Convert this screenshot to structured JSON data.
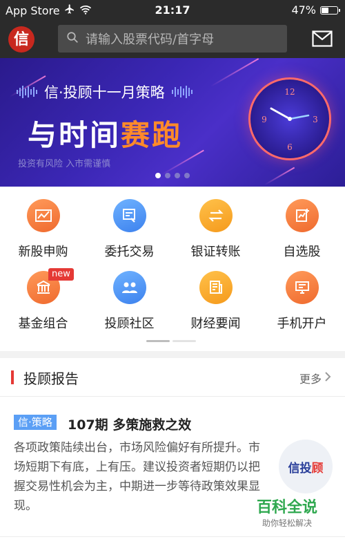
{
  "status": {
    "back_app": "App Store",
    "time": "21:17",
    "battery": "47%"
  },
  "header": {
    "logo_char": "信",
    "search_placeholder": "请输入股票代码/首字母",
    "icons": {
      "search": "search-icon",
      "mail": "mail-icon"
    }
  },
  "banner": {
    "subtitle": "信·投顾十一月策略",
    "title_main": "与时间",
    "title_accent": "赛跑",
    "note": "投资有风险 入市需谨慎",
    "slides": 4,
    "active_slide": 1
  },
  "grid": {
    "items": [
      {
        "label": "新股申购",
        "icon": "ipo-chart-icon",
        "color": "orange"
      },
      {
        "label": "委托交易",
        "icon": "trade-card-icon",
        "color": "blue"
      },
      {
        "label": "银证转账",
        "icon": "transfer-icon",
        "color": "yellow"
      },
      {
        "label": "自选股",
        "icon": "watchlist-icon",
        "color": "orange"
      },
      {
        "label": "基金组合",
        "icon": "fund-bank-icon",
        "color": "orange",
        "badge": "new"
      },
      {
        "label": "投顾社区",
        "icon": "community-icon",
        "color": "blue"
      },
      {
        "label": "财经要闻",
        "icon": "news-icon",
        "color": "yellow"
      },
      {
        "label": "手机开户",
        "icon": "open-account-icon",
        "color": "orange"
      }
    ],
    "pages": 2,
    "active_page": 1
  },
  "section": {
    "title": "投顾报告",
    "more": "更多"
  },
  "report": {
    "tag": "信·策略",
    "headline": "107期 多策施救之效",
    "body": "各项政策陆续出台，市场风险偏好有所提升。市场短期下有底，上有压。建议投资者短期仍以把握交易性机会为主，中期进一步等待政策效果显现。",
    "thumb_text_main": "信投",
    "thumb_text_accent": "顾"
  },
  "watermark": {
    "title": "百科全说",
    "subtitle": "助你轻松解决"
  },
  "colors": {
    "header_bg": "#2b2b2b",
    "accent_red": "#e53935",
    "tag_blue": "#5b9ff5",
    "banner_orange": "#ff8a2a"
  }
}
